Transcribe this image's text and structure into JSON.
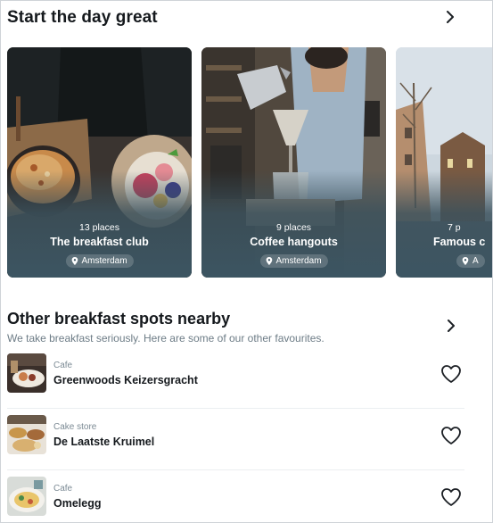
{
  "featured": {
    "title": "Start the day great",
    "cards": [
      {
        "count": "13 places",
        "name": "The breakfast club",
        "location": "Amsterdam"
      },
      {
        "count": "9 places",
        "name": "Coffee hangouts",
        "location": "Amsterdam"
      },
      {
        "count": "7 p",
        "name": "Famous c",
        "location": "A"
      }
    ]
  },
  "nearby": {
    "title": "Other breakfast spots nearby",
    "subtitle": "We take breakfast seriously. Here are some of our other favourites.",
    "items": [
      {
        "category": "Cafe",
        "name": "Greenwoods Keizersgracht"
      },
      {
        "category": "Cake store",
        "name": "De Laatste Kruimel"
      },
      {
        "category": "Cafe",
        "name": "Omelegg"
      }
    ]
  },
  "icons": {
    "chevron": "chevron-right-icon",
    "pin": "map-pin-icon",
    "heart": "heart-outline-icon"
  },
  "colors": {
    "card_overlay": "#3c5562",
    "subtitle_text": "#6d7c86"
  }
}
